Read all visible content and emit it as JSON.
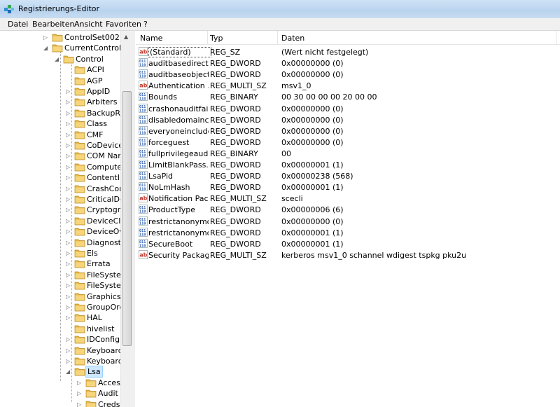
{
  "window": {
    "title": "Registrierungs-Editor"
  },
  "menu": [
    "Datei",
    "Bearbeiten",
    "Ansicht",
    "Favoriten",
    "?"
  ],
  "tree": {
    "items": [
      {
        "label": "ControlSet002",
        "expander": "closed"
      },
      {
        "label": "CurrentControlSet",
        "expander": "open"
      },
      {
        "label": "Control",
        "expander": "open"
      },
      {
        "label": "ACPI",
        "expander": "none"
      },
      {
        "label": "AGP",
        "expander": "none"
      },
      {
        "label": "AppID",
        "expander": "closed"
      },
      {
        "label": "Arbiters",
        "expander": "closed"
      },
      {
        "label": "BackupRes",
        "expander": "closed"
      },
      {
        "label": "Class",
        "expander": "closed"
      },
      {
        "label": "CMF",
        "expander": "closed"
      },
      {
        "label": "CoDeviceIr",
        "expander": "closed"
      },
      {
        "label": "COM Nam",
        "expander": "closed"
      },
      {
        "label": "Computerl",
        "expander": "closed"
      },
      {
        "label": "ContentInc",
        "expander": "closed"
      },
      {
        "label": "CrashCont",
        "expander": "closed"
      },
      {
        "label": "CriticalDev",
        "expander": "closed"
      },
      {
        "label": "Cryptograp",
        "expander": "closed"
      },
      {
        "label": "DeviceClas",
        "expander": "closed"
      },
      {
        "label": "DeviceOve",
        "expander": "closed"
      },
      {
        "label": "Diagnostic",
        "expander": "closed"
      },
      {
        "label": "Els",
        "expander": "closed"
      },
      {
        "label": "Errata",
        "expander": "closed"
      },
      {
        "label": "FileSystem",
        "expander": "closed"
      },
      {
        "label": "FileSystem",
        "expander": "closed"
      },
      {
        "label": "GraphicsDr",
        "expander": "closed"
      },
      {
        "label": "GroupOrde",
        "expander": "closed"
      },
      {
        "label": "HAL",
        "expander": "closed"
      },
      {
        "label": "hivelist",
        "expander": "none"
      },
      {
        "label": "IDConfigDl",
        "expander": "closed"
      },
      {
        "label": "Keyboard L",
        "expander": "closed"
      },
      {
        "label": "Keyboard L",
        "expander": "closed"
      },
      {
        "label": "Lsa",
        "expander": "open"
      },
      {
        "label": "Access",
        "expander": "closed"
      },
      {
        "label": "Audit",
        "expander": "closed"
      },
      {
        "label": "Credss",
        "expander": "closed"
      }
    ]
  },
  "columns": {
    "name": "Name",
    "type": "Typ",
    "data": "Daten"
  },
  "values": [
    {
      "name": "(Standard)",
      "type": "REG_SZ",
      "data": "(Wert nicht festgelegt)",
      "icon": "string-value-icon"
    },
    {
      "name": "auditbasedirect...",
      "type": "REG_DWORD",
      "data": "0x00000000 (0)",
      "icon": "binary-value-icon"
    },
    {
      "name": "auditbaseobjects",
      "type": "REG_DWORD",
      "data": "0x00000000 (0)",
      "icon": "binary-value-icon"
    },
    {
      "name": "Authentication ...",
      "type": "REG_MULTI_SZ",
      "data": "msv1_0",
      "icon": "string-value-icon"
    },
    {
      "name": "Bounds",
      "type": "REG_BINARY",
      "data": "00 30 00 00 00 20 00 00",
      "icon": "binary-value-icon"
    },
    {
      "name": "crashonauditfail",
      "type": "REG_DWORD",
      "data": "0x00000000 (0)",
      "icon": "binary-value-icon"
    },
    {
      "name": "disabledomainc...",
      "type": "REG_DWORD",
      "data": "0x00000000 (0)",
      "icon": "binary-value-icon"
    },
    {
      "name": "everyoneinclude...",
      "type": "REG_DWORD",
      "data": "0x00000000 (0)",
      "icon": "binary-value-icon"
    },
    {
      "name": "forceguest",
      "type": "REG_DWORD",
      "data": "0x00000000 (0)",
      "icon": "binary-value-icon"
    },
    {
      "name": "fullprivilegeaudi...",
      "type": "REG_BINARY",
      "data": "00",
      "icon": "binary-value-icon"
    },
    {
      "name": "LimitBlankPass...",
      "type": "REG_DWORD",
      "data": "0x00000001 (1)",
      "icon": "binary-value-icon"
    },
    {
      "name": "LsaPid",
      "type": "REG_DWORD",
      "data": "0x00000238 (568)",
      "icon": "binary-value-icon"
    },
    {
      "name": "NoLmHash",
      "type": "REG_DWORD",
      "data": "0x00000001 (1)",
      "icon": "binary-value-icon"
    },
    {
      "name": "Notification Pac...",
      "type": "REG_MULTI_SZ",
      "data": "scecli",
      "icon": "string-value-icon"
    },
    {
      "name": "ProductType",
      "type": "REG_DWORD",
      "data": "0x00000006 (6)",
      "icon": "binary-value-icon"
    },
    {
      "name": "restrictanonymo...",
      "type": "REG_DWORD",
      "data": "0x00000000 (0)",
      "icon": "binary-value-icon"
    },
    {
      "name": "restrictanonymo...",
      "type": "REG_DWORD",
      "data": "0x00000001 (1)",
      "icon": "binary-value-icon"
    },
    {
      "name": "SecureBoot",
      "type": "REG_DWORD",
      "data": "0x00000001 (1)",
      "icon": "binary-value-icon"
    },
    {
      "name": "Security Packages",
      "type": "REG_MULTI_SZ",
      "data": "kerberos msv1_0 schannel wdigest tspkg pku2u",
      "icon": "string-value-icon"
    }
  ],
  "colors": {
    "folder": "#e8b84a",
    "selection": "#cde8ff",
    "string_icon_red": "#c0392b",
    "binary_icon_blue": "#2a5db0"
  }
}
